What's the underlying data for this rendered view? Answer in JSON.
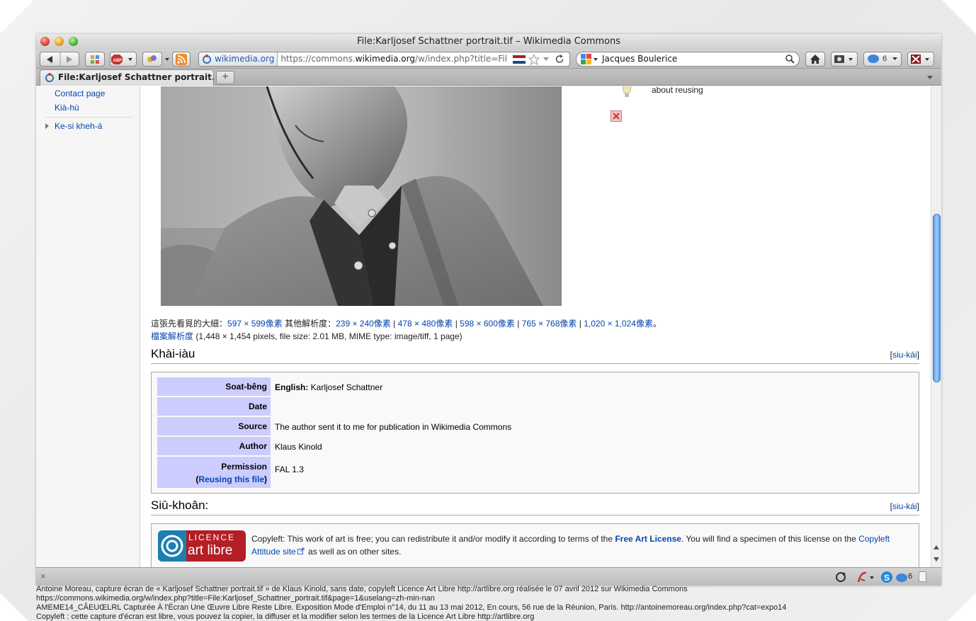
{
  "window": {
    "title": "File:Karljosef Schattner portrait.tif – Wikimedia Commons"
  },
  "toolbar": {
    "site_identity": "wikimedia.org",
    "url_prefix": "https://commons.",
    "url_domain": "wikimedia.org",
    "url_rest": "/w/index.php?title=Fil",
    "search_value": "Jacques Boulerice",
    "chat_count": "6"
  },
  "tab": {
    "label": "File:Karljosef Schattner portrait....",
    "new_tab": "+"
  },
  "sidebar": {
    "items": [
      "Contact page",
      "Kià-hù"
    ],
    "collapsible": "Ke-si kheh-á"
  },
  "right_panel": {
    "reuse_text": "about reusing"
  },
  "resolution": {
    "prefix": "這張先看覓的大細：",
    "preview": "597 × 599像素",
    "other_label": " 其他解析度：",
    "others": [
      "239 × 240像素",
      "478 × 480像素",
      "598 × 600像素",
      "765 × 768像素",
      "1,020 × 1,024像素"
    ],
    "sep": " | ",
    "end": "。",
    "full_link": "檔案解析度",
    "full_info": " (1,448 × 1,454 pixels, file size: 2.01 MB, MIME type: image/tiff, 1 page)"
  },
  "summary": {
    "heading": "Khài-iàu",
    "edit": "siu-kái",
    "rows": [
      {
        "label": "Soat-bêng",
        "value_bold": "English:",
        "value": " Karljosef Schattner"
      },
      {
        "label": "Date",
        "value_bold": "",
        "value": ""
      },
      {
        "label": "Source",
        "value_bold": "",
        "value": "The author sent it to me for publication in Wikimedia Commons"
      },
      {
        "label": "Author",
        "value_bold": "",
        "value": "Klaus Kinold"
      },
      {
        "label": "Permission",
        "value_bold": "",
        "value": "FAL 1.3"
      }
    ],
    "reusing_link": "Reusing this file"
  },
  "licensing": {
    "heading": "Siū-khoân:",
    "edit": "siu-kái",
    "logo_top": "LICENCE",
    "logo_bottom": "art libre",
    "text_1": "Copyleft: This work of art is free; you can redistribute it and/or modify it according to terms of the ",
    "fal_link": "Free Art License",
    "text_2": ". You will find a specimen of this license on the ",
    "copyleft_link_a": "Copyleft",
    "copyleft_link_b": "Attitude site",
    "text_3": " as well as on other sites."
  },
  "statusbar": {
    "close": "×",
    "chat_count": "6"
  },
  "caption": {
    "line1": "Antoine Moreau, capture écran de « Karljosef Schattner portrait.tif » de Klaus Kinold, sans date, copyleft Licence Art Libre http://artlibre.org réalisée le 07 avril 2012 sur Wikimedia Commons",
    "line2": "https://commons.wikimedia.org/w/index.php?title=File:Karljosef_Schattner_portrait.tif&page=1&uselang=zh-min-nan",
    "line3": "AMEME14_CÂEUŒLRL Capturée À l'Écran Une Œuvre Libre Reste Libre. Exposition Mode d'Emploi n°14, du 11 au 13 mai 2012, En cours, 56 rue de la Réunion, Paris. http://antoinemoreau.org/index.php?cat=expo14",
    "line4": "Copyleft : cette capture d'écran est libre, vous pouvez la copier, la diffuser et la modifier selon les termes de la Licence Art Libre http://artlibre.org"
  }
}
